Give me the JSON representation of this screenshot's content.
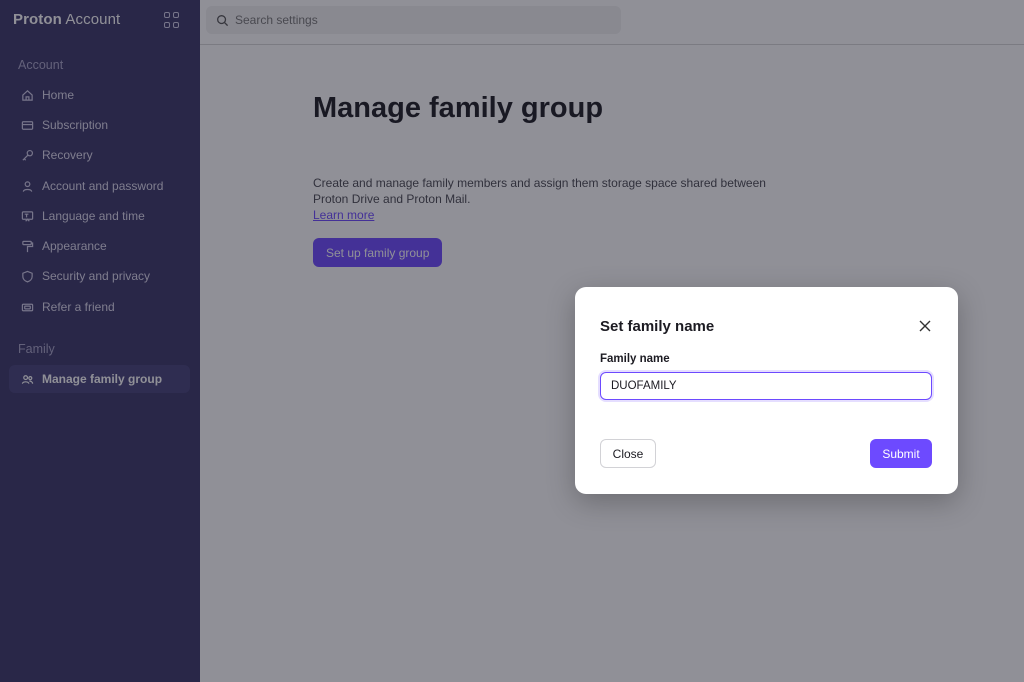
{
  "app": {
    "logo_brand": "Proton",
    "logo_product": "Account"
  },
  "search": {
    "placeholder": "Search settings"
  },
  "sidebar": {
    "sections": [
      {
        "label": "Account"
      },
      {
        "label": "Family"
      }
    ],
    "items": [
      {
        "label": "Home",
        "icon": "home-icon"
      },
      {
        "label": "Subscription",
        "icon": "credit-card-icon"
      },
      {
        "label": "Recovery",
        "icon": "key-icon"
      },
      {
        "label": "Account and password",
        "icon": "user-icon"
      },
      {
        "label": "Language and time",
        "icon": "language-icon"
      },
      {
        "label": "Appearance",
        "icon": "paint-roller-icon"
      },
      {
        "label": "Security and privacy",
        "icon": "shield-icon"
      },
      {
        "label": "Refer a friend",
        "icon": "ticket-icon"
      },
      {
        "label": "Manage family group",
        "icon": "users-icon",
        "active": true
      }
    ]
  },
  "main": {
    "title": "Manage family group",
    "description": "Create and manage family members and assign them storage space shared between Proton Drive and Proton Mail.",
    "learn_more": "Learn more",
    "setup_button": "Set up family group"
  },
  "modal": {
    "title": "Set family name",
    "field_label": "Family name",
    "field_value": "DUOFAMILY",
    "close_button": "Close",
    "submit_button": "Submit"
  },
  "colors": {
    "accent": "#6d4aff",
    "sidebar_bg": "#3a3668",
    "text": "#1c1b22"
  }
}
